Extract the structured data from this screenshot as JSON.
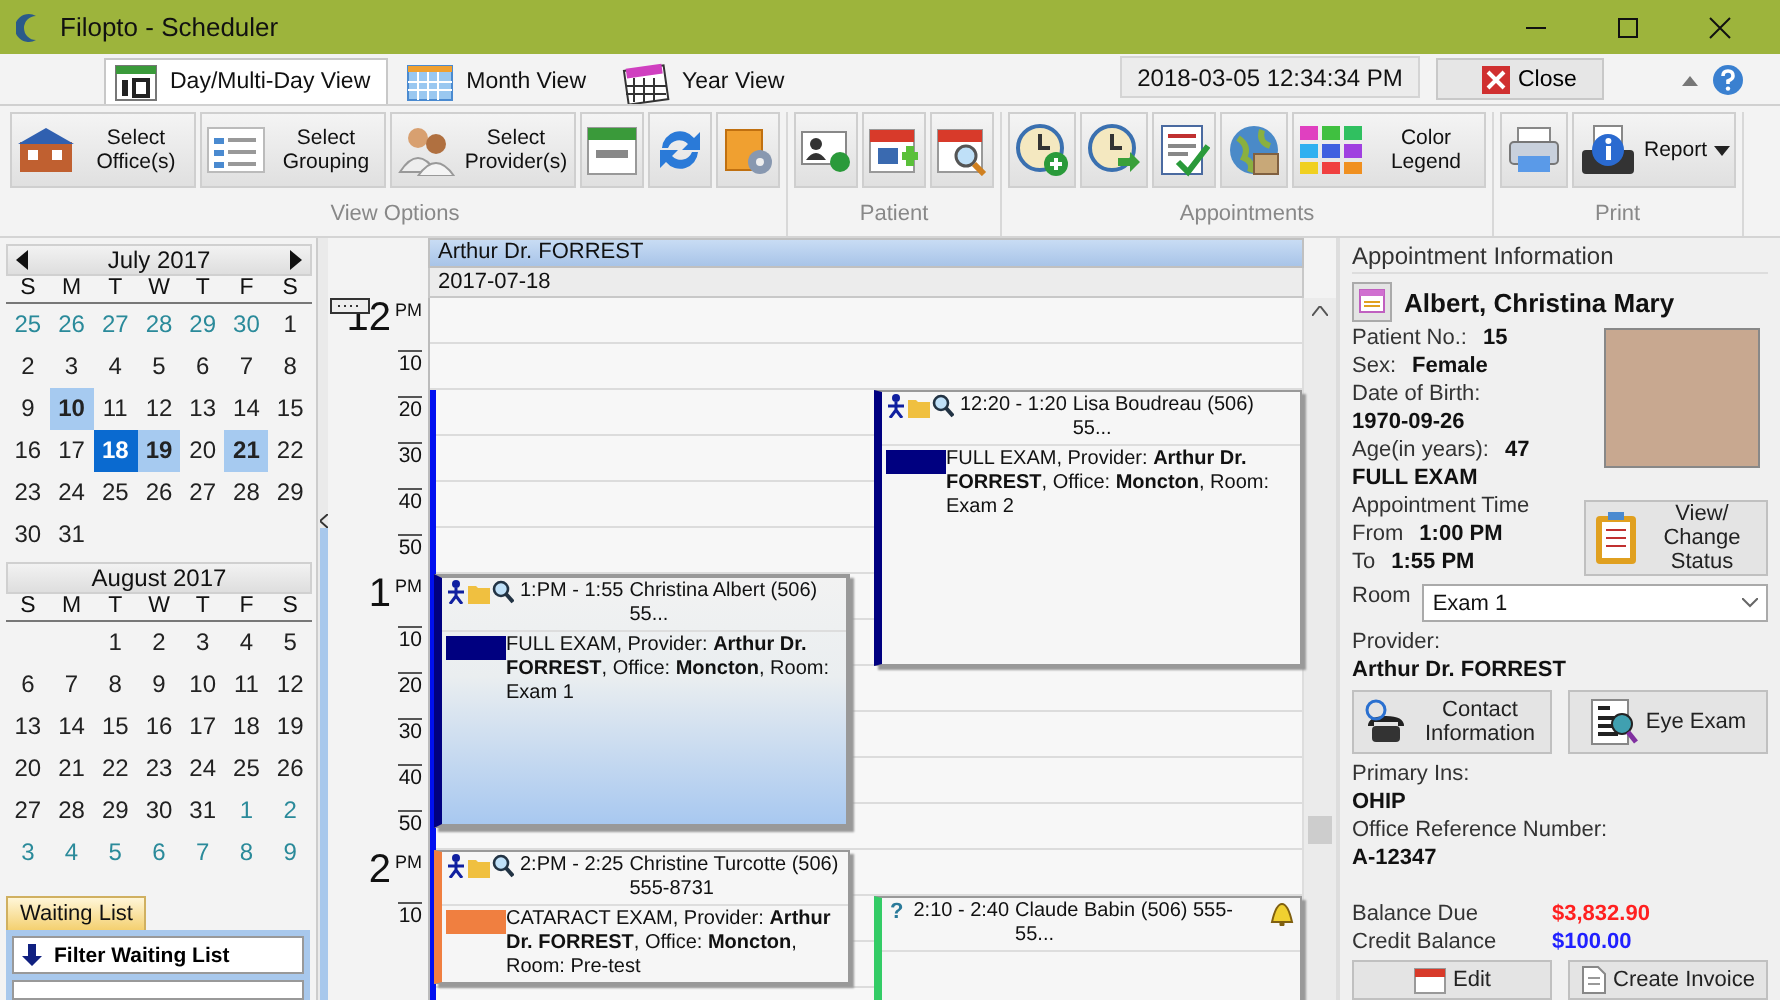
{
  "window": {
    "title": "Filopto - Scheduler"
  },
  "tabs": [
    {
      "label": "Day/Multi-Day View",
      "selected": true
    },
    {
      "label": "Month View",
      "selected": false
    },
    {
      "label": "Year View",
      "selected": false
    }
  ],
  "clock": "2018-03-05 12:34:34 PM",
  "close_button": "Close",
  "toolbar": [
    {
      "label": "View Options",
      "buttons": [
        {
          "kind": "labeled",
          "label": "Select Office(s)"
        },
        {
          "kind": "labeled",
          "label": "Select Grouping"
        },
        {
          "kind": "labeled",
          "label": "Select Provider(s)"
        },
        {
          "kind": "icon"
        },
        {
          "kind": "icon"
        },
        {
          "kind": "icon"
        }
      ]
    },
    {
      "label": "Patient",
      "buttons": [
        {
          "kind": "icon"
        },
        {
          "kind": "icon"
        },
        {
          "kind": "icon"
        }
      ]
    },
    {
      "label": "Appointments",
      "buttons": [
        {
          "kind": "icon"
        },
        {
          "kind": "icon"
        },
        {
          "kind": "icon"
        },
        {
          "kind": "icon"
        },
        {
          "kind": "labeled",
          "label": "Color Legend"
        }
      ]
    },
    {
      "label": "Print",
      "buttons": [
        {
          "kind": "icon"
        },
        {
          "kind": "menu",
          "label": "Report"
        }
      ]
    }
  ],
  "calendars": [
    {
      "title": "July 2017",
      "arrows": true,
      "weekdays": [
        "S",
        "M",
        "T",
        "W",
        "T",
        "F",
        "S"
      ],
      "weeks": [
        [
          {
            "day": "25",
            "other_month": true,
            "selected": false,
            "highlighted": false
          },
          {
            "day": "26",
            "other_month": true,
            "selected": false,
            "highlighted": false
          },
          {
            "day": "27",
            "other_month": true,
            "selected": false,
            "highlighted": false
          },
          {
            "day": "28",
            "other_month": true,
            "selected": false,
            "highlighted": false
          },
          {
            "day": "29",
            "other_month": true,
            "selected": false,
            "highlighted": false
          },
          {
            "day": "30",
            "other_month": true,
            "selected": false,
            "highlighted": false
          },
          {
            "day": "1",
            "other_month": false,
            "selected": false,
            "highlighted": false
          }
        ],
        [
          {
            "day": "2",
            "other_month": false,
            "selected": false,
            "highlighted": false
          },
          {
            "day": "3",
            "other_month": false,
            "selected": false,
            "highlighted": false
          },
          {
            "day": "4",
            "other_month": false,
            "selected": false,
            "highlighted": false
          },
          {
            "day": "5",
            "other_month": false,
            "selected": false,
            "highlighted": false
          },
          {
            "day": "6",
            "other_month": false,
            "selected": false,
            "highlighted": false
          },
          {
            "day": "7",
            "other_month": false,
            "selected": false,
            "highlighted": false
          },
          {
            "day": "8",
            "other_month": false,
            "selected": false,
            "highlighted": false
          }
        ],
        [
          {
            "day": "9",
            "other_month": false,
            "selected": false,
            "highlighted": false
          },
          {
            "day": "10",
            "other_month": false,
            "selected": false,
            "highlighted": true
          },
          {
            "day": "11",
            "other_month": false,
            "selected": false,
            "highlighted": false
          },
          {
            "day": "12",
            "other_month": false,
            "selected": false,
            "highlighted": false
          },
          {
            "day": "13",
            "other_month": false,
            "selected": false,
            "highlighted": false
          },
          {
            "day": "14",
            "other_month": false,
            "selected": false,
            "highlighted": false
          },
          {
            "day": "15",
            "other_month": false,
            "selected": false,
            "highlighted": false
          }
        ],
        [
          {
            "day": "16",
            "other_month": false,
            "selected": false,
            "highlighted": false
          },
          {
            "day": "17",
            "other_month": false,
            "selected": false,
            "highlighted": false
          },
          {
            "day": "18",
            "other_month": false,
            "selected": true,
            "highlighted": false
          },
          {
            "day": "19",
            "other_month": false,
            "selected": false,
            "highlighted": true
          },
          {
            "day": "20",
            "other_month": false,
            "selected": false,
            "highlighted": false
          },
          {
            "day": "21",
            "other_month": false,
            "selected": false,
            "highlighted": true
          },
          {
            "day": "22",
            "other_month": false,
            "selected": false,
            "highlighted": false
          }
        ],
        [
          {
            "day": "23",
            "other_month": false,
            "selected": false,
            "highlighted": false
          },
          {
            "day": "24",
            "other_month": false,
            "selected": false,
            "highlighted": false
          },
          {
            "day": "25",
            "other_month": false,
            "selected": false,
            "highlighted": false
          },
          {
            "day": "26",
            "other_month": false,
            "selected": false,
            "highlighted": false
          },
          {
            "day": "27",
            "other_month": false,
            "selected": false,
            "highlighted": false
          },
          {
            "day": "28",
            "other_month": false,
            "selected": false,
            "highlighted": false
          },
          {
            "day": "29",
            "other_month": false,
            "selected": false,
            "highlighted": false
          }
        ],
        [
          {
            "day": "30",
            "other_month": false,
            "selected": false,
            "highlighted": false
          },
          {
            "day": "31",
            "other_month": false,
            "selected": false,
            "highlighted": false
          }
        ]
      ]
    },
    {
      "title": "August 2017",
      "arrows": false,
      "weekdays": [
        "S",
        "M",
        "T",
        "W",
        "T",
        "F",
        "S"
      ],
      "weeks": [
        [
          {
            "day": "1",
            "other_month": false,
            "selected": false,
            "highlighted": false
          },
          {
            "day": "2",
            "other_month": false,
            "selected": false,
            "highlighted": false
          },
          {
            "day": "3",
            "other_month": false,
            "selected": false,
            "highlighted": false
          },
          {
            "day": "4",
            "other_month": false,
            "selected": false,
            "highlighted": false
          },
          {
            "day": "5",
            "other_month": false,
            "selected": false,
            "highlighted": false
          }
        ],
        [
          {
            "day": "6",
            "other_month": false,
            "selected": false,
            "highlighted": false
          },
          {
            "day": "7",
            "other_month": false,
            "selected": false,
            "highlighted": false
          },
          {
            "day": "8",
            "other_month": false,
            "selected": false,
            "highlighted": false
          },
          {
            "day": "9",
            "other_month": false,
            "selected": false,
            "highlighted": false
          },
          {
            "day": "10",
            "other_month": false,
            "selected": false,
            "highlighted": false
          },
          {
            "day": "11",
            "other_month": false,
            "selected": false,
            "highlighted": false
          },
          {
            "day": "12",
            "other_month": false,
            "selected": false,
            "highlighted": false
          }
        ],
        [
          {
            "day": "13",
            "other_month": false,
            "selected": false,
            "highlighted": false
          },
          {
            "day": "14",
            "other_month": false,
            "selected": false,
            "highlighted": false
          },
          {
            "day": "15",
            "other_month": false,
            "selected": false,
            "highlighted": false
          },
          {
            "day": "16",
            "other_month": false,
            "selected": false,
            "highlighted": false
          },
          {
            "day": "17",
            "other_month": false,
            "selected": false,
            "highlighted": false
          },
          {
            "day": "18",
            "other_month": false,
            "selected": false,
            "highlighted": false
          },
          {
            "day": "19",
            "other_month": false,
            "selected": false,
            "highlighted": false
          }
        ],
        [
          {
            "day": "20",
            "other_month": false,
            "selected": false,
            "highlighted": false
          },
          {
            "day": "21",
            "other_month": false,
            "selected": false,
            "highlighted": false
          },
          {
            "day": "22",
            "other_month": false,
            "selected": false,
            "highlighted": false
          },
          {
            "day": "23",
            "other_month": false,
            "selected": false,
            "highlighted": false
          },
          {
            "day": "24",
            "other_month": false,
            "selected": false,
            "highlighted": false
          },
          {
            "day": "25",
            "other_month": false,
            "selected": false,
            "highlighted": false
          },
          {
            "day": "26",
            "other_month": false,
            "selected": false,
            "highlighted": false
          }
        ],
        [
          {
            "day": "27",
            "other_month": false,
            "selected": false,
            "highlighted": false
          },
          {
            "day": "28",
            "other_month": false,
            "selected": false,
            "highlighted": false
          },
          {
            "day": "29",
            "other_month": false,
            "selected": false,
            "highlighted": false
          },
          {
            "day": "30",
            "other_month": false,
            "selected": false,
            "highlighted": false
          },
          {
            "day": "31",
            "other_month": false,
            "selected": false,
            "highlighted": false
          },
          {
            "day": "1",
            "other_month": true,
            "selected": false,
            "highlighted": false
          },
          {
            "day": "2",
            "other_month": true,
            "selected": false,
            "highlighted": false
          }
        ],
        [
          {
            "day": "3",
            "other_month": true,
            "selected": false,
            "highlighted": false
          },
          {
            "day": "4",
            "other_month": true,
            "selected": false,
            "highlighted": false
          },
          {
            "day": "5",
            "other_month": true,
            "selected": false,
            "highlighted": false
          },
          {
            "day": "6",
            "other_month": true,
            "selected": false,
            "highlighted": false
          },
          {
            "day": "7",
            "other_month": true,
            "selected": false,
            "highlighted": false
          },
          {
            "day": "8",
            "other_month": true,
            "selected": false,
            "highlighted": false
          },
          {
            "day": "9",
            "other_month": true,
            "selected": false,
            "highlighted": false
          }
        ]
      ]
    }
  ],
  "waiting_list": {
    "tab": "Waiting List",
    "filter_button": "Filter Waiting List"
  },
  "schedule": {
    "provider": "Arthur Dr. FORREST",
    "date": "2017-07-18",
    "time_labels": [
      {
        "kind": "hour",
        "text": "12",
        "suffix": "PM"
      },
      {
        "kind": "minute",
        "text": "10"
      },
      {
        "kind": "minute",
        "text": "20"
      },
      {
        "kind": "minute",
        "text": "30"
      },
      {
        "kind": "minute",
        "text": "40"
      },
      {
        "kind": "minute",
        "text": "50"
      },
      {
        "kind": "hour",
        "text": "1",
        "suffix": "PM"
      },
      {
        "kind": "minute",
        "text": "10"
      },
      {
        "kind": "minute",
        "text": "20"
      },
      {
        "kind": "minute",
        "text": "30"
      },
      {
        "kind": "minute",
        "text": "40"
      },
      {
        "kind": "minute",
        "text": "50"
      },
      {
        "kind": "hour",
        "text": "2",
        "suffix": "PM"
      },
      {
        "kind": "minute",
        "text": "10"
      }
    ],
    "appointments": [
      {
        "kind": "booked",
        "second_column": true,
        "color": "#000080",
        "selected": false,
        "time": "12:20 - 1:20",
        "header": "Lisa Boudreau  (506) 55...",
        "description": "FULL EXAM, Provider: **Arthur Dr. FORREST**, Office: **Moncton**, Room: Exam 2"
      },
      {
        "kind": "booked",
        "second_column": false,
        "color": "#000080",
        "selected": true,
        "time": "1:PM - 1:55",
        "header": "Christina Albert  (506) 55...",
        "description": "FULL EXAM, Provider: **Arthur Dr. FORREST**, Office: **Moncton**, Room: Exam 1"
      },
      {
        "kind": "booked",
        "second_column": false,
        "color": "#f07f40",
        "selected": false,
        "time": "2:PM - 2:25",
        "header": "Christine Turcotte  (506) 555-8731",
        "description": "CATARACT EXAM, Provider: **Arthur Dr. FORREST**, Office: **Moncton**, Room: Pre-test"
      },
      {
        "kind": "pending",
        "second_column": true,
        "color": "#33cc66",
        "selected": false,
        "mark": "?",
        "time": "2:10 - 2:40",
        "header": "Claude Babin  (506) 555-55..."
      }
    ]
  },
  "appointment_info": {
    "title": "Appointment Information",
    "patient_name": "Albert, Christina Mary",
    "details": [
      {
        "kind": "inline",
        "label": "Patient No.:",
        "value": "15"
      },
      {
        "kind": "inline",
        "label": "Sex:",
        "value": "Female"
      },
      {
        "kind": "stacked",
        "label": "Date of Birth:",
        "value": "1970-09-26"
      },
      {
        "kind": "inline",
        "label": "Age(in years):",
        "value": "47"
      },
      {
        "kind": "value",
        "value": "FULL EXAM"
      },
      {
        "kind": "label",
        "label": "Appointment Time"
      },
      {
        "kind": "inline",
        "label": "From",
        "value": "1:00 PM"
      },
      {
        "kind": "inline",
        "label": "To",
        "value": "1:55 PM"
      }
    ],
    "status_button": "View/ Change Status",
    "room": {
      "label": "Room",
      "value": "Exam 1"
    },
    "provider": {
      "label": "Provider:",
      "value": "Arthur Dr. FORREST"
    },
    "buttons": [
      "Contact Information",
      "Eye Exam"
    ],
    "more_details": [
      {
        "kind": "stacked",
        "label": "Primary Ins:",
        "value": "OHIP"
      },
      {
        "kind": "stacked",
        "label": "Office Reference Number:",
        "value": "A-12347"
      }
    ],
    "balances": [
      {
        "label": "Balance Due",
        "value": "$3,832.90",
        "color": "#ff2020"
      },
      {
        "label": "Credit Balance",
        "value": "$100.00",
        "color": "#2020ff"
      }
    ],
    "footer_buttons": [
      "Edit",
      "Create Invoice"
    ]
  }
}
